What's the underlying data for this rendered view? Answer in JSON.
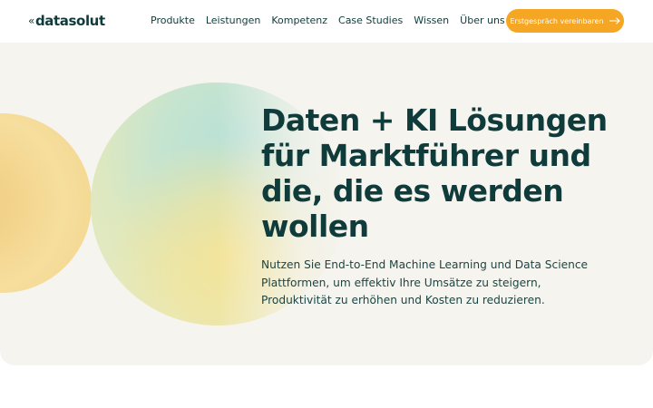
{
  "header": {
    "logo_mark": "«",
    "logo_text": "datasolut",
    "nav": [
      "Produkte",
      "Leistungen",
      "Kompetenz",
      "Case Studies",
      "Wissen",
      "Über uns"
    ],
    "cta_label": "Erstgespräch vereinbaren",
    "cta_icon": "arrow-right-icon"
  },
  "hero": {
    "title": "Daten + KI Lösungen für Marktführer und die, die es werden wollen",
    "subtitle": "Nutzen Sie End-to-End Machine Learning und Data Science Plattformen, um effektiv Ihre Umsätze zu steigern, Produktivität zu erhöhen und Kosten zu reduzieren."
  },
  "colors": {
    "accent": "#f5a623",
    "text": "#0f3b3a",
    "hero_bg": "#f6f4ef"
  }
}
